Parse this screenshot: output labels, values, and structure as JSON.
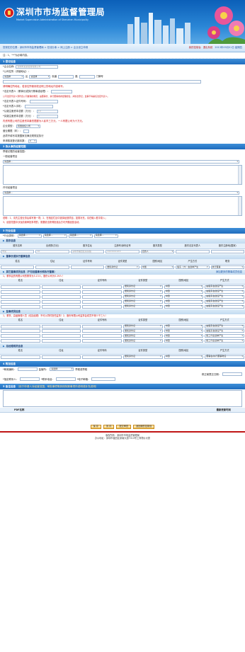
{
  "header": {
    "title": "深圳市市场监督管理局",
    "subtitle": "Market Supervision Administration of Shenzhen Municipality"
  },
  "nav": {
    "location": "您现在的位置：深圳市市场监督管理局 > 在线办事 > 网上注册 > 企业设立申请",
    "my_system": "我的控制台",
    "exit": "退出系统",
    "date": "2013年09月01日 星期四"
  },
  "notice": "注：1、\"*\"为必填内容。",
  "s1": {
    "title": "1  登记信息",
    "name_label": "*企业名称:",
    "name_value": "深圳市某某贸易有限公司",
    "address_label": "*公司住所（详细地址）：",
    "addr_sel1": "请选择",
    "addr_sel2": "请选择",
    "street": "街道",
    "road": "路",
    "no": "门牌号",
    "note_addr": "请明确住所地址，若该住所使用权证明上的地址内容填写。",
    "rep_label": "*法定代表人（董事长或执行董事或经理）：",
    "note_rep": "公司法定代表人须符合公司章程的规定，由董事长、执行董事或者经理担任，并依法登记，监事不得兼任法定代表人。",
    "rep_id_label": "*法定代表人证件号码：",
    "rep_phone_label": "*法定代表人手机：",
    "capital_label": "*认缴注册资本总额（万元）：",
    "capital_value": "10",
    "paid_label": "*实缴注册资本总额（万元）：",
    "paid_value": "0",
    "note_cap": "内资有限公司的注册资本最低限额为人民币三万元，一人有限公司为十万元。",
    "type_label": "企业类型：",
    "type_value": "有限责任公司",
    "years_label": "营业期限（年）：",
    "years_note": "此项不填写将按国家法律法规规定执行",
    "copies_label": "申请核准登记副本数：",
    "copies_value": "0"
  },
  "s2": {
    "title": "2  拟从事的经营范围",
    "general_label": "章程记载的经营范围：",
    "general_sub": "一般经营项目",
    "licensed_sub": "许可经营项目",
    "sel": "请选择...",
    "note1": "说明：1、请先主营业务后填写第一项；2、在相应栏目中选择经营项目，如需补充，请在输入框中录入；",
    "note2": "3、经营范围中涉及前置审批事项的，需要依法获得批准后方可开展经营活动。"
  },
  "s3": {
    "title": "3  行业信息",
    "ind_label": "*行业类别：",
    "sel": "请选择..."
  },
  "shareholder": {
    "title": "股东信息",
    "cols": [
      "股东名称",
      "出资额(万元)",
      "股东住址",
      "注册号/身份证号",
      "股东类型",
      "股东法定代表人",
      "股东注册地(国家)"
    ],
    "name": "甲某",
    "amount": "10",
    "addr": "深圳市福田区某某路",
    "id": "44030419XX",
    "type": "自然人"
  },
  "director": {
    "title": "董事长或执行董事信息",
    "cols": [
      "姓名",
      "住址",
      "证件号码",
      "证件类型",
      "国别/地区",
      "产生方式",
      "职务"
    ],
    "idtype": "居民身份证",
    "country": "中国",
    "method": "股东（大）会选举产生",
    "position": "执行董事"
  },
  "others": {
    "title": "其它董事成员信息（不包括董事长和执行董事）",
    "add": "添加更多的董事成员信息",
    "note": "1、董事会的有限公司的董事为3-13人，股份公司为5-19人！",
    "cols": [
      "姓名",
      "住址",
      "证件号码",
      "证件类型",
      "国别/地区",
      "产生方式"
    ],
    "idtype": "居民身份证",
    "country": "中国",
    "method": "由股东会选任产生"
  },
  "supervisor": {
    "title": "监事成员信息",
    "note": "1、董事、高级管理人员（包括经理）不可以同时担任监事！2、股份有限公司监事会成员不得少于三人！",
    "cols": [
      "姓名",
      "住址",
      "证件号码",
      "证件类型",
      "国别/地区",
      "产生方式"
    ],
    "idtype": "居民身份证",
    "country": "中国",
    "method": "由股东会选任产生",
    "method2": "职工代表选举产生"
  },
  "manager": {
    "title": "总经理成员信息",
    "cols": [
      "姓名",
      "住址",
      "证件号码",
      "证件类型",
      "国别/地区",
      "产生方式"
    ],
    "idtype": "居民身份证",
    "country": "中国",
    "method": "董事会/执行董事聘任"
  },
  "s4": {
    "title": "4  附加信息",
    "zip": "*邮政编码：",
    "dept": "监管所：",
    "sel": "请选择",
    "addr_change": "章程或章程",
    "annual": "修正案提交日期：",
    "contact": "*指定联系人：",
    "phone": "*联系电话：",
    "email": "*电子邮箱："
  },
  "s5": {
    "title": "5  备注信息",
    "note": "（用于申请人对经营范围、审批事项等其他特殊事项作说明或补充说明）",
    "pdf_name": "PDF名称",
    "update": "最新更新时间"
  },
  "buttons": [
    "保 存",
    "暂 存",
    "提交审查",
    "返回我的控制台"
  ],
  "footer": {
    "line1": "版权所有：深圳市市场监督管理局",
    "line2": "办公地址：深圳市福田区深南大道7010号工商物价大厦"
  }
}
